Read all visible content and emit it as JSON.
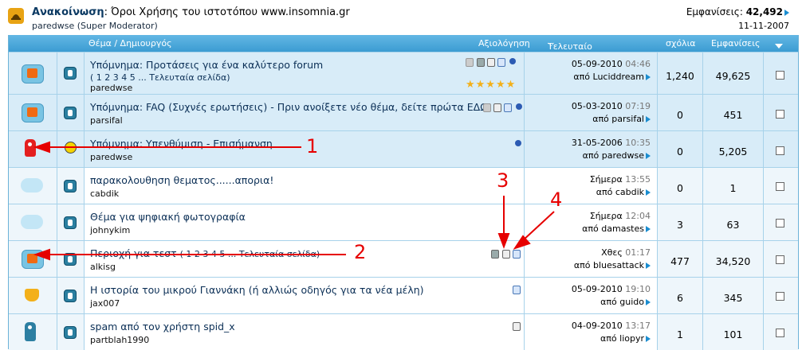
{
  "announcement": {
    "label": "Ανακοίνωση",
    "title": ": Όροι Χρήσης του ιστοτόπου www.insomnia.gr",
    "author": "paredwse (Super Moderator)",
    "views_label": "Εμφανίσεις:",
    "views_value": "42,492",
    "date": "11-11-2007"
  },
  "header": {
    "topic": "Θέμα / Δημιουργός",
    "rating": "Αξιολόγηση",
    "last_post": "Τελευταίο μήνυμα",
    "replies": "σχόλια",
    "views": "Εμφανίσεις"
  },
  "rows": [
    {
      "title": "Υπόμνημα: Προτάσεις για ένα καλύτερο forum",
      "pages": "( 1 2 3 4 5 ... Τελευταία σελίδα)",
      "author": "paredwse",
      "date": "05-09-2010",
      "time": "04:46",
      "by": "από Luciddream",
      "replies": "1,240",
      "views": "49,625"
    },
    {
      "title": "Υπόμνημα: FAQ (Συχνές ερωτήσεις) - Πριν ανοίξετε νέο θέμα, δείτε πρώτα ΕΔΩ!",
      "author": "parsifal",
      "date": "05-03-2010",
      "time": "07:19",
      "by": "από parsifal",
      "replies": "0",
      "views": "451"
    },
    {
      "title": "Υπόμνημα: Υπενθύμιση - Επισήμανση",
      "author": "paredwse",
      "date": "31-05-2006",
      "time": "10:35",
      "by": "από paredwse",
      "replies": "0",
      "views": "5,205"
    },
    {
      "title": "παρακολουθηση θεματος......απορια!",
      "author": "cabdik",
      "date": "Σήμερα",
      "time": "13:55",
      "by": "από cabdik",
      "replies": "0",
      "views": "1"
    },
    {
      "title": "Θέμα για ψηφιακή φωτογραφία",
      "author": "johnykim",
      "date": "Σήμερα",
      "time": "12:04",
      "by": "από damastes",
      "replies": "3",
      "views": "63"
    },
    {
      "title": "Περιοχή για τεστ",
      "pages": "( 1 2 3 4 5 ... Τελευταία σελίδα)",
      "author": "alkisg",
      "date": "Χθες",
      "time": "01:17",
      "by": "από bluesattack",
      "replies": "477",
      "views": "34,520"
    },
    {
      "title": "Η ιστορία του μικρού Γιαννάκη (ή αλλιώς οδηγός για τα νέα μέλη)",
      "author": "jax007",
      "date": "05-09-2010",
      "time": "19:10",
      "by": "από guido",
      "replies": "6",
      "views": "345"
    },
    {
      "title": "spam από τον χρήστη spid_x",
      "author": "partblah1990",
      "date": "04-09-2010",
      "time": "13:17",
      "by": "από liopyr",
      "replies": "1",
      "views": "101"
    }
  ],
  "stars": "★★★★★",
  "annotations": [
    "1",
    "2",
    "3",
    "4"
  ],
  "colors": {
    "header": "#3b9cd2",
    "sticky_bg": "#d8ecf8",
    "annotation": "#e60000"
  }
}
